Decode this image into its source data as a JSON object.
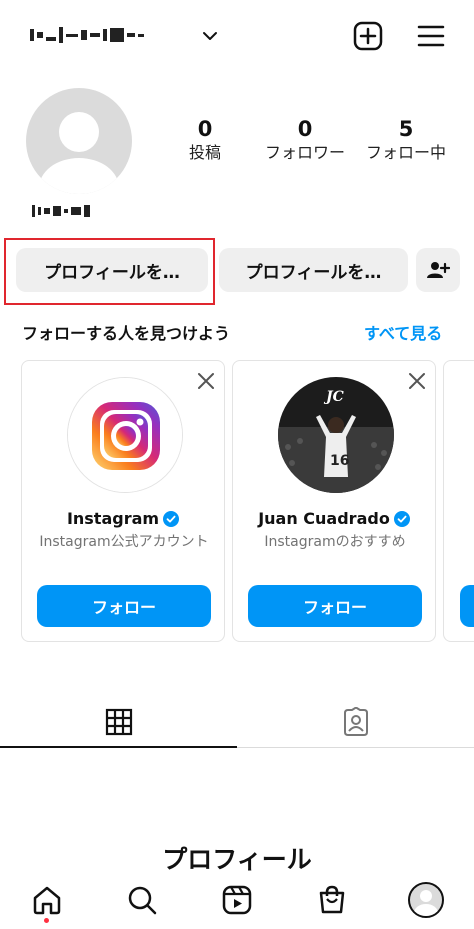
{
  "stats": [
    {
      "count": "0",
      "label": "投稿"
    },
    {
      "count": "0",
      "label": "フォロワー"
    },
    {
      "count": "5",
      "label": "フォロー中"
    }
  ],
  "buttons": {
    "edit_profile": "プロフィールを…",
    "share_profile": "プロフィールを…"
  },
  "discover": {
    "title": "フォローする人を見つけよう",
    "see_all": "すべて見る",
    "cards": [
      {
        "name": "Instagram",
        "subtitle": "Instagram公式アカウント",
        "follow_label": "フォロー",
        "verified": true
      },
      {
        "name": "Juan Cuadrado",
        "subtitle": "Instagramのおすすめ",
        "follow_label": "フォロー",
        "verified": true
      }
    ]
  },
  "caption": "プロフィール",
  "colors": {
    "accent": "#0095f6",
    "highlight": "#e0262e",
    "notification_dot": "#ff3040"
  },
  "icons": {
    "top": [
      "chevron-down-icon",
      "create-icon",
      "menu-icon"
    ],
    "tabs": [
      "grid-icon",
      "tagged-icon"
    ],
    "nav": [
      "home-icon",
      "search-icon",
      "reels-icon",
      "shop-icon",
      "profile-avatar"
    ]
  }
}
